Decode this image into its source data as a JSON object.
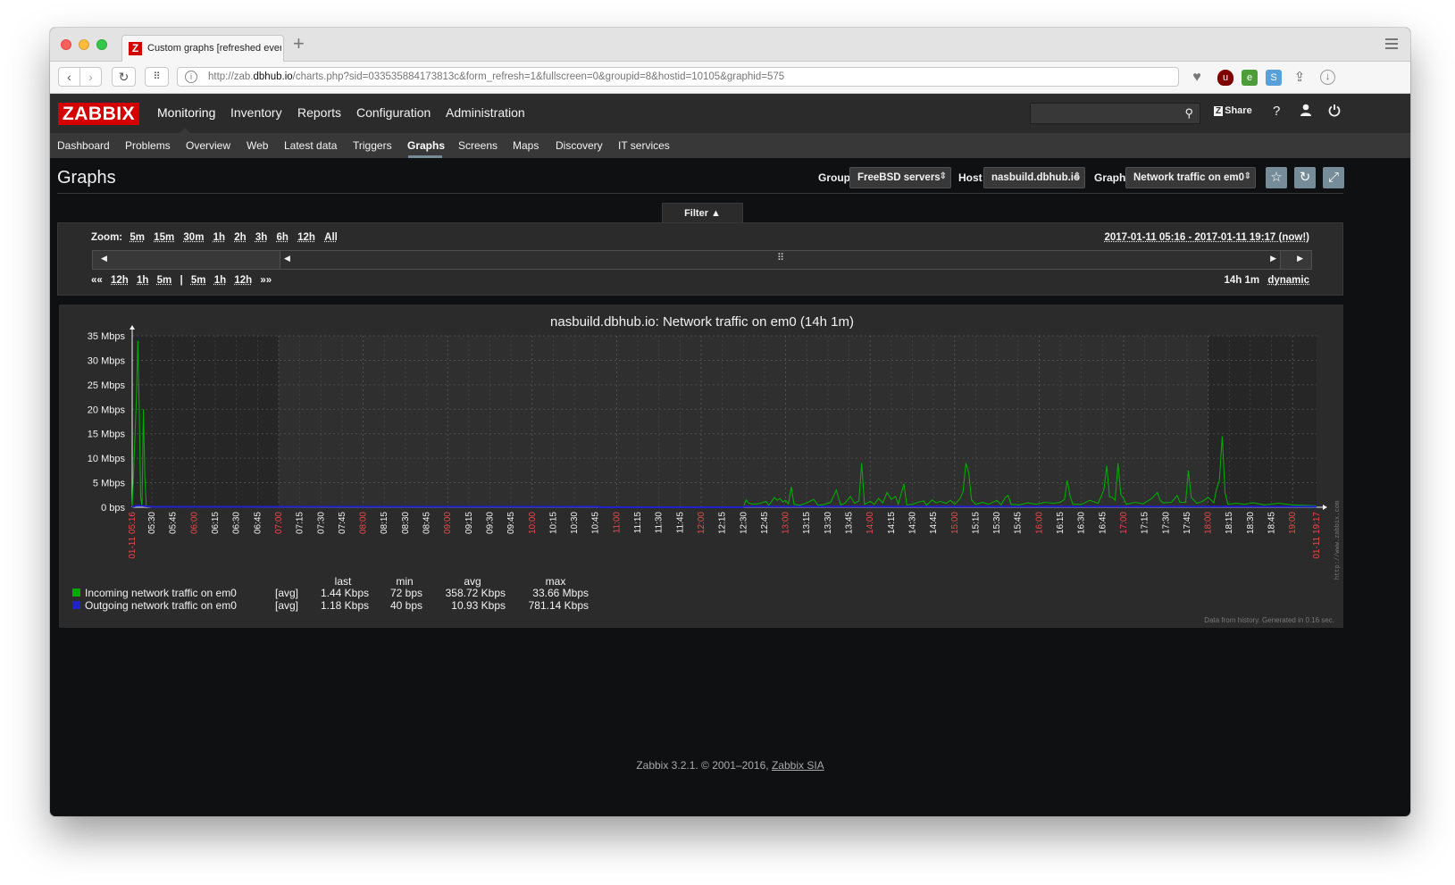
{
  "browser": {
    "tab_title": "Custom graphs [refreshed every",
    "url_prefix": "http://zab.",
    "url_domain": "dbhub.io",
    "url_rest": "/charts.php?sid=033535884173813c&form_refresh=1&fullscreen=0&groupid=8&hostid=10105&graphid=575"
  },
  "header": {
    "logo": "ZABBIX",
    "nav": [
      "Monitoring",
      "Inventory",
      "Reports",
      "Configuration",
      "Administration"
    ],
    "share_label": "Share",
    "help_label": "?",
    "icons": [
      "search-icon",
      "user-icon",
      "power-icon"
    ]
  },
  "subnav": [
    "Dashboard",
    "Problems",
    "Overview",
    "Web",
    "Latest data",
    "Triggers",
    "Graphs",
    "Screens",
    "Maps",
    "Discovery",
    "IT services"
  ],
  "page": {
    "title": "Graphs",
    "group_label": "Group",
    "group_value": "FreeBSD servers",
    "host_label": "Host",
    "host_value": "nasbuild.dbhub.io",
    "graph_label": "Graph",
    "graph_value": "Network traffic on em0"
  },
  "filter": {
    "tab_label": "Filter ▲",
    "zoom_label": "Zoom:",
    "zoom_options": [
      "5m",
      "15m",
      "30m",
      "1h",
      "2h",
      "3h",
      "6h",
      "12h",
      "All"
    ],
    "range": "2017-01-11 05:16 - 2017-01-11 19:17 (now!)",
    "back_fast": "««",
    "back_steps": [
      "12h",
      "1h",
      "5m"
    ],
    "separator": "|",
    "fwd_steps": [
      "5m",
      "1h",
      "12h"
    ],
    "fwd_fast": "»»",
    "period": "14h 1m",
    "mode": "dynamic",
    "scroll_position": 0.12,
    "scroll_size": 0.82
  },
  "chart_data": {
    "type": "line",
    "title": "nasbuild.dbhub.io: Network traffic on em0 (14h 1m)",
    "y_ticks": [
      "0 bps",
      "5 Mbps",
      "10 Mbps",
      "15 Mbps",
      "20 Mbps",
      "25 Mbps",
      "30 Mbps",
      "35 Mbps"
    ],
    "ylim": [
      0,
      35
    ],
    "y_unit": "Mbps",
    "x_start_label": "01-11 05:16",
    "x_end_label": "01-11 19:17",
    "x_ticks": [
      "05:30",
      "05:45",
      "06:00",
      "06:15",
      "06:30",
      "06:45",
      "07:00",
      "07:15",
      "07:30",
      "07:45",
      "08:00",
      "08:15",
      "08:30",
      "08:45",
      "09:00",
      "09:15",
      "09:30",
      "09:45",
      "10:00",
      "10:15",
      "10:30",
      "10:45",
      "11:00",
      "11:15",
      "11:30",
      "11:45",
      "12:00",
      "12:15",
      "12:30",
      "12:45",
      "13:00",
      "13:15",
      "13:30",
      "13:45",
      "14:00",
      "14:15",
      "14:30",
      "14:45",
      "15:00",
      "15:15",
      "15:30",
      "15:45",
      "16:00",
      "16:15",
      "16:30",
      "16:45",
      "17:00",
      "17:15",
      "17:30",
      "17:45",
      "18:00",
      "18:15",
      "18:30",
      "18:45",
      "19:00"
    ],
    "x_range_minutes": [
      316,
      1157
    ],
    "series": [
      {
        "name": "Incoming network traffic on em0",
        "color": "#00aa00",
        "points": [
          [
            316,
            0.1
          ],
          [
            319,
            22
          ],
          [
            320,
            34
          ],
          [
            321,
            20
          ],
          [
            322,
            2
          ],
          [
            323,
            0.3
          ],
          [
            324,
            20
          ],
          [
            325,
            6
          ],
          [
            326,
            0.3
          ],
          [
            329,
            0.1
          ],
          [
            330,
            0.1
          ],
          [
            750,
            0.1
          ],
          [
            752,
            1.5
          ],
          [
            754,
            0.8
          ],
          [
            758,
            0.6
          ],
          [
            762,
            0.8
          ],
          [
            766,
            1.2
          ],
          [
            768,
            0.4
          ],
          [
            772,
            2.0
          ],
          [
            774,
            1.4
          ],
          [
            776,
            1.8
          ],
          [
            778,
            1.1
          ],
          [
            780,
            1.4
          ],
          [
            782,
            0.7
          ],
          [
            784,
            4.2
          ],
          [
            786,
            0.6
          ],
          [
            790,
            0.4
          ],
          [
            795,
            0.9
          ],
          [
            800,
            1.6
          ],
          [
            803,
            0.4
          ],
          [
            808,
            0.6
          ],
          [
            812,
            1.0
          ],
          [
            816,
            3.5
          ],
          [
            819,
            0.5
          ],
          [
            822,
            0.8
          ],
          [
            826,
            2.2
          ],
          [
            829,
            0.8
          ],
          [
            832,
            1.3
          ],
          [
            834,
            9.0
          ],
          [
            836,
            0.6
          ],
          [
            840,
            1.2
          ],
          [
            843,
            0.6
          ],
          [
            846,
            1.8
          ],
          [
            849,
            0.9
          ],
          [
            852,
            3.0
          ],
          [
            855,
            1.6
          ],
          [
            858,
            2.2
          ],
          [
            860,
            0.6
          ],
          [
            864,
            4.8
          ],
          [
            866,
            0.5
          ],
          [
            870,
            0.6
          ],
          [
            874,
            1.0
          ],
          [
            878,
            1.3
          ],
          [
            880,
            0.4
          ],
          [
            884,
            1.5
          ],
          [
            887,
            0.9
          ],
          [
            890,
            1.2
          ],
          [
            894,
            0.8
          ],
          [
            897,
            1.4
          ],
          [
            900,
            0.6
          ],
          [
            904,
            1.8
          ],
          [
            906,
            3.2
          ],
          [
            908,
            9.0
          ],
          [
            910,
            7.0
          ],
          [
            912,
            1.5
          ],
          [
            915,
            0.6
          ],
          [
            920,
            1.0
          ],
          [
            924,
            0.6
          ],
          [
            930,
            1.4
          ],
          [
            933,
            0.5
          ],
          [
            936,
            2.0
          ],
          [
            938,
            2.4
          ],
          [
            940,
            0.6
          ],
          [
            946,
            0.5
          ],
          [
            952,
            0.9
          ],
          [
            958,
            0.6
          ],
          [
            964,
            1.0
          ],
          [
            970,
            0.8
          ],
          [
            975,
            1.0
          ],
          [
            978,
            1.6
          ],
          [
            980,
            5.5
          ],
          [
            982,
            2.2
          ],
          [
            984,
            0.6
          ],
          [
            990,
            0.6
          ],
          [
            996,
            1.4
          ],
          [
            1002,
            0.8
          ],
          [
            1006,
            3.6
          ],
          [
            1008,
            8.5
          ],
          [
            1010,
            2.1
          ],
          [
            1012,
            2.0
          ],
          [
            1014,
            1.4
          ],
          [
            1016,
            9.0
          ],
          [
            1018,
            2.6
          ],
          [
            1020,
            1.8
          ],
          [
            1022,
            0.6
          ],
          [
            1028,
            1.0
          ],
          [
            1034,
            0.7
          ],
          [
            1040,
            1.8
          ],
          [
            1044,
            3.0
          ],
          [
            1046,
            1.4
          ],
          [
            1048,
            0.9
          ],
          [
            1054,
            1.0
          ],
          [
            1058,
            2.4
          ],
          [
            1060,
            1.0
          ],
          [
            1064,
            1.0
          ],
          [
            1066,
            7.5
          ],
          [
            1068,
            2.0
          ],
          [
            1072,
            0.8
          ],
          [
            1076,
            1.2
          ],
          [
            1080,
            2.0
          ],
          [
            1082,
            1.5
          ],
          [
            1084,
            0.9
          ],
          [
            1086,
            3.8
          ],
          [
            1088,
            5.5
          ],
          [
            1090,
            14.5
          ],
          [
            1092,
            3.0
          ],
          [
            1094,
            0.6
          ],
          [
            1100,
            0.8
          ],
          [
            1106,
            0.6
          ],
          [
            1112,
            0.9
          ],
          [
            1120,
            0.5
          ],
          [
            1130,
            0.8
          ],
          [
            1140,
            0.5
          ],
          [
            1157,
            0.3
          ]
        ]
      },
      {
        "name": "Outgoing network traffic on em0",
        "color": "#2222cc",
        "points": [
          [
            316,
            0.1
          ],
          [
            320,
            0.35
          ],
          [
            330,
            0.1
          ],
          [
            647,
            0.12
          ],
          [
            648,
            0.0
          ],
          [
            749,
            0.0
          ],
          [
            750,
            0.12
          ],
          [
            1157,
            0.12
          ]
        ]
      }
    ],
    "legend": {
      "headers": [
        "last",
        "min",
        "avg",
        "max"
      ],
      "rows": [
        {
          "name": "Incoming network traffic on em0",
          "color": "#00aa00",
          "func": "[avg]",
          "last": "1.44 Kbps",
          "min": "72 bps",
          "avg": "358.72 Kbps",
          "max": "33.66 Mbps"
        },
        {
          "name": "Outgoing network traffic on em0",
          "color": "#2222cc",
          "func": "[avg]",
          "last": "1.18 Kbps",
          "min": "40 bps",
          "avg": "10.93 Kbps",
          "max": "781.14 Kbps"
        }
      ]
    },
    "footnote": "Data from history. Generated in 0.16 sec.",
    "watermark": "http://www.zabbix.com"
  },
  "footer": {
    "text": "Zabbix 3.2.1. © 2001–2016,",
    "link": "Zabbix SIA"
  }
}
